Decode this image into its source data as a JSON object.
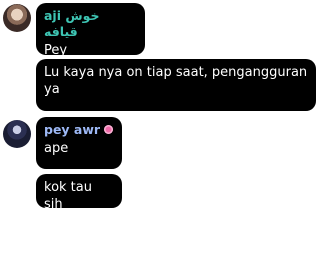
{
  "messages": [
    {
      "sender": "aji خوش قيافه",
      "text": "Pey"
    },
    {
      "text": "Lu kaya nya on tiap saat, pengangguran ya"
    },
    {
      "sender": "pey awr",
      "badge_icon": "flower-badge-icon",
      "text": "ape"
    },
    {
      "text": "kok tau sih"
    }
  ],
  "colors": {
    "bubble": "#000000",
    "text": "#ffffff",
    "sender1": "#3ec5b4",
    "sender2": "#9db8f5",
    "badge": "#f06aa8"
  }
}
